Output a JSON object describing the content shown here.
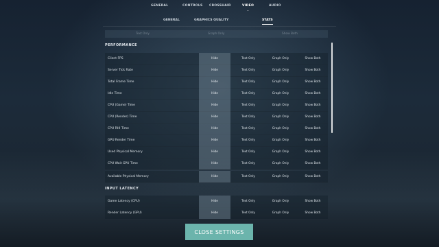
{
  "top_nav": {
    "tabs": [
      {
        "label": "GENERAL",
        "active": false
      },
      {
        "label": "CONTROLS",
        "active": false
      },
      {
        "label": "CROSSHAIR",
        "active": false
      },
      {
        "label": "VIDEO",
        "active": true
      },
      {
        "label": "AUDIO",
        "active": false
      }
    ]
  },
  "sub_nav": {
    "tabs": [
      {
        "label": "GENERAL",
        "active": false
      },
      {
        "label": "GRAPHICS QUALITY",
        "active": false
      },
      {
        "label": "STATS",
        "active": true
      }
    ]
  },
  "header_strip": {
    "text_only": "Text Only",
    "graph_only": "Graph Only",
    "show_both": "Show Both"
  },
  "options": {
    "hide": "Hide",
    "text_only": "Text Only",
    "graph_only": "Graph Only",
    "show_both": "Show Both"
  },
  "sections": {
    "performance": {
      "title": "PERFORMANCE",
      "rows": [
        {
          "label": "Client FPS",
          "selected": "Hide"
        },
        {
          "label": "Server Tick Rate",
          "selected": "Hide"
        },
        {
          "label": "Total Frame Time",
          "selected": "Hide"
        },
        {
          "label": "Idle Time",
          "selected": "Hide"
        },
        {
          "label": "CPU (Game) Time",
          "selected": "Hide"
        },
        {
          "label": "CPU (Render) Time",
          "selected": "Hide"
        },
        {
          "label": "CPU RHI Time",
          "selected": "Hide"
        },
        {
          "label": "GPU Render Time",
          "selected": "Hide"
        },
        {
          "label": "Used Physical Memory",
          "selected": "Hide"
        },
        {
          "label": "CPU Wait GPU Time",
          "selected": "Hide"
        },
        {
          "label": "Available Physical Memory",
          "selected": "Hide"
        }
      ]
    },
    "input_latency": {
      "title": "INPUT LATENCY",
      "rows": [
        {
          "label": "Game Latency (CPU)",
          "selected": "Hide"
        },
        {
          "label": "Render Latency (GPU)",
          "selected": "Hide"
        }
      ]
    }
  },
  "close_button": {
    "label": "CLOSE SETTINGS"
  },
  "colors": {
    "accent": "#6bb4ac",
    "selected_cell": "#78909b"
  }
}
